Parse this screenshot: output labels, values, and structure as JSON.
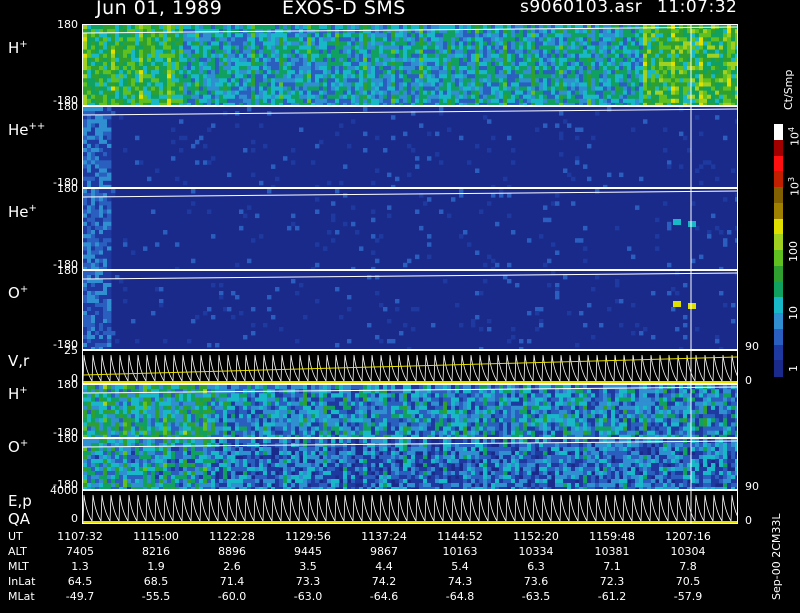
{
  "header": {
    "date": "Jun 01, 1989",
    "instrument": "EXOS-D SMS",
    "file": "s9060103.asr",
    "time": "11:07:32"
  },
  "colorbar": {
    "unit_label": "Ct/Smp",
    "ticks": [
      "1",
      "10",
      "100",
      "10",
      "10"
    ],
    "tick_exps": [
      "",
      "",
      "",
      "3",
      "4"
    ],
    "colors": [
      "#1a2a8a",
      "#1e3aa0",
      "#2a5fc0",
      "#2f8fd0",
      "#18b8c8",
      "#10a060",
      "#2fa02f",
      "#60c020",
      "#a0d020",
      "#e0e000",
      "#a08000",
      "#806000",
      "#c02000",
      "#ff1010",
      "#a00000",
      "#ffffff"
    ]
  },
  "panels": [
    {
      "id": "h-plus-top",
      "label": "H",
      "sup": "+",
      "ytop": "180",
      "ybot": "-180"
    },
    {
      "id": "he-plusplus",
      "label": "He",
      "sup": "++",
      "ytop": "180",
      "ybot": "-180"
    },
    {
      "id": "he-plus",
      "label": "He",
      "sup": "+",
      "ytop": "180",
      "ybot": "-180"
    },
    {
      "id": "o-plus-top",
      "label": "O",
      "sup": "+",
      "ytop": "180",
      "ybot": "-180",
      "right_tick": "90"
    },
    {
      "id": "vr",
      "label": "V,r",
      "sup": "",
      "ytop": "25",
      "ybot": "0",
      "right_tick": "0"
    },
    {
      "id": "h-plus-bottom",
      "label": "H",
      "sup": "+",
      "ytop": "180",
      "ybot": "-180"
    },
    {
      "id": "o-plus-bottom",
      "label": "O",
      "sup": "+",
      "ytop": "180",
      "ybot": "-180",
      "right_tick": "90"
    },
    {
      "id": "ep",
      "label": "E,p",
      "sup": "",
      "ytop": "4000",
      "ybot": "0",
      "right_tick": "0",
      "extra_label": "QA"
    }
  ],
  "chart_data": {
    "type": "heatmap",
    "title": "Jun 01, 1989   EXOS-D SMS",
    "xlabel": "UT",
    "rows": [
      {
        "name": "UT",
        "values": [
          "1107:32",
          "1115:00",
          "1122:28",
          "1129:56",
          "1137:24",
          "1144:52",
          "1152:20",
          "1159:48",
          "1207:16"
        ]
      },
      {
        "name": "ALT",
        "values": [
          "7405",
          "8216",
          "8896",
          "9445",
          "9867",
          "10163",
          "10334",
          "10381",
          "10304"
        ]
      },
      {
        "name": "MLT",
        "values": [
          "1.3",
          "1.9",
          "2.6",
          "3.5",
          "4.4",
          "5.4",
          "6.3",
          "7.1",
          "7.8"
        ]
      },
      {
        "name": "InLat",
        "values": [
          "64.5",
          "68.5",
          "71.4",
          "73.3",
          "74.2",
          "74.3",
          "73.6",
          "72.3",
          "70.5"
        ]
      },
      {
        "name": "MLat",
        "values": [
          "-49.7",
          "-55.5",
          "-60.0",
          "-63.0",
          "-64.6",
          "-64.8",
          "-63.5",
          "-61.2",
          "-57.9"
        ]
      }
    ],
    "colorbar_label": "Ct/Smp",
    "colorbar_scale": "log"
  },
  "side_note": "Sep-00 2CM33L"
}
